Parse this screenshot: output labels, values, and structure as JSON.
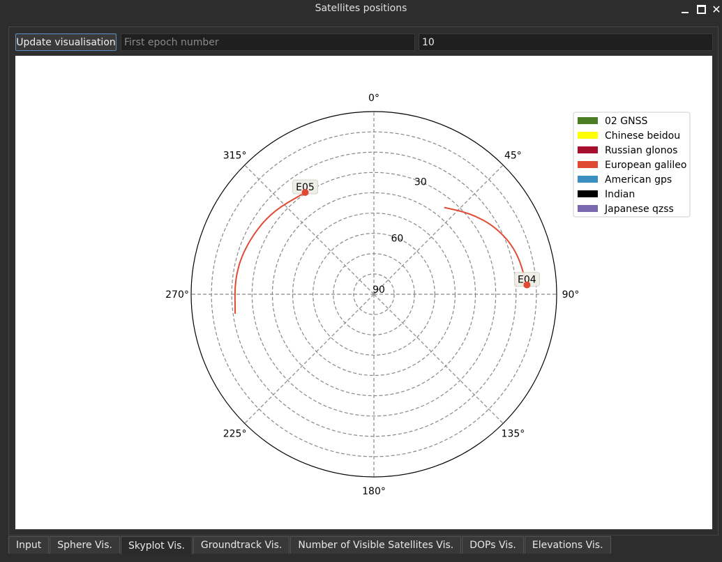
{
  "window": {
    "title": "Satellites positions"
  },
  "toolbar": {
    "update_label": "Update visualisation",
    "epoch_placeholder": "First epoch number",
    "count_value": "10"
  },
  "tabs": [
    {
      "label": "Input",
      "active": false
    },
    {
      "label": "Sphere Vis.",
      "active": false
    },
    {
      "label": "Skyplot Vis.",
      "active": true
    },
    {
      "label": "Groundtrack Vis.",
      "active": false
    },
    {
      "label": "Number of Visible Satellites Vis.",
      "active": false
    },
    {
      "label": "DOPs Vis.",
      "active": false
    },
    {
      "label": "Elevations Vis.",
      "active": false
    }
  ],
  "chart_data": {
    "type": "scatter",
    "projection": "polar-skyplot",
    "azimuth_ticks": [
      "0°",
      "45°",
      "90°",
      "135°",
      "180°",
      "225°",
      "270°",
      "315°"
    ],
    "elevation_ticks": [
      "30",
      "60",
      "90"
    ],
    "legend": [
      {
        "label": "02  GNSS",
        "color": "#4a7c23"
      },
      {
        "label": "Chinese beidou",
        "color": "#ffff00"
      },
      {
        "label": "Russian glonos",
        "color": "#a50f2d"
      },
      {
        "label": "European galileo",
        "color": "#e04a33"
      },
      {
        "label": "American gps",
        "color": "#3a8ec2"
      },
      {
        "label": "Indian",
        "color": "#000000"
      },
      {
        "label": "Japanese qzss",
        "color": "#7b67ae"
      }
    ],
    "legend_position": "top-right",
    "grid": true,
    "series": [
      {
        "name": "E05",
        "color": "#e04a33",
        "track": [
          {
            "az": 262,
            "el": 21
          },
          {
            "az": 277,
            "el": 21
          },
          {
            "az": 291,
            "el": 22.5
          },
          {
            "az": 308,
            "el": 25
          },
          {
            "az": 326,
            "el": 29.5
          }
        ],
        "current": {
          "az": 326,
          "el": 29.5
        }
      },
      {
        "name": "E04",
        "color": "#e04a33",
        "track": [
          {
            "az": 39,
            "el": 35
          },
          {
            "az": 50,
            "el": 28
          },
          {
            "az": 61,
            "el": 21.5
          },
          {
            "az": 73,
            "el": 16.5
          },
          {
            "az": 86.5,
            "el": 14.5
          }
        ],
        "current": {
          "az": 86.5,
          "el": 14.5
        }
      }
    ]
  }
}
